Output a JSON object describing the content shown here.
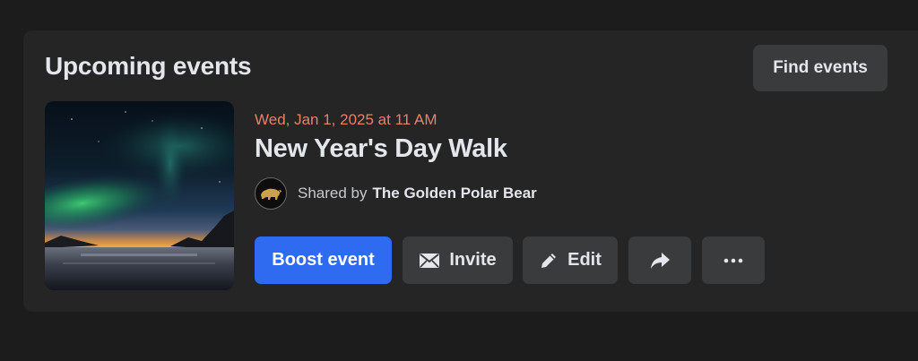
{
  "header": {
    "title": "Upcoming events",
    "find_events_label": "Find events"
  },
  "event": {
    "date": "Wed, Jan 1, 2025 at 11 AM",
    "name": "New Year's Day Walk",
    "shared_prefix": "Shared by",
    "shared_by": "The Golden Polar Bear",
    "image_icon": "aurora-landscape-image",
    "avatar_icon": "golden-polar-bear-avatar"
  },
  "actions": {
    "boost_label": "Boost event",
    "invite_label": "Invite",
    "edit_label": "Edit",
    "share_icon": "share-arrow-icon",
    "more_icon": "more-dots-icon"
  },
  "colors": {
    "background": "#1c1c1d",
    "card": "#252526",
    "button": "#3a3b3c",
    "primary_button": "#2f6bf0",
    "date_text": "#e5826b",
    "text": "#e4e6eb"
  }
}
